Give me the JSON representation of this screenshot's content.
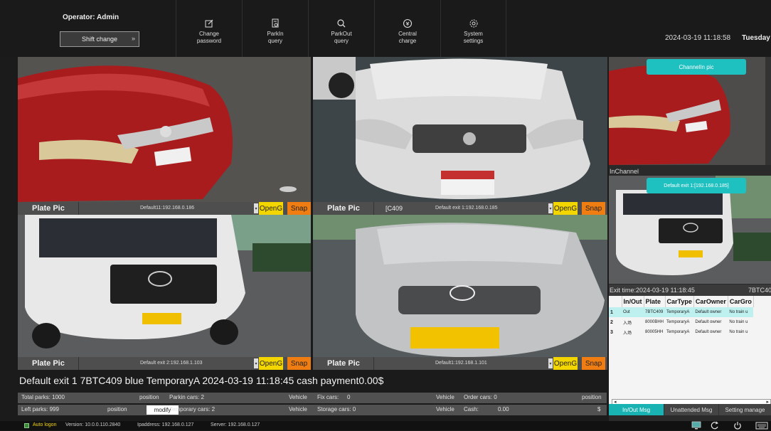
{
  "operator": {
    "label": "Operator:",
    "name": "Admin"
  },
  "shift_change": "Shift change",
  "nav": [
    {
      "label": "Change\npassword",
      "icon": "edit-icon"
    },
    {
      "label": "ParkIn\nquery",
      "icon": "parkin-query-icon"
    },
    {
      "label": "ParkOut\nquery",
      "icon": "search-icon"
    },
    {
      "label": "Central\ncharge",
      "icon": "coin-icon"
    },
    {
      "label": "System\nsettings",
      "icon": "gear-icon"
    }
  ],
  "datetime": "2024-03-19 11:18:58",
  "weekday": "Tuesday",
  "cameras": [
    {
      "plate_label": "Plate Pic",
      "plate_text": "",
      "ip": "Default11:192.168.0.186",
      "open": "OpenG",
      "snap": "Snap"
    },
    {
      "plate_label": "Plate Pic",
      "plate_text": "[C409",
      "ip": "Default exit 1:192.168.0.185",
      "open": "OpenG",
      "snap": "Snap"
    },
    {
      "plate_label": "Plate Pic",
      "plate_text": "",
      "ip": "Default exit 2:192.168.1.103",
      "open": "OpenG",
      "snap": "Snap"
    },
    {
      "plate_label": "Plate Pic",
      "plate_text": "",
      "ip": "Default1:192.168.1.101",
      "open": "OpenG",
      "snap": "Snap"
    }
  ],
  "info_line": "Default exit 1  7BTC409  blue  TemporaryA  2024-03-19 11:18:45  cash payment0.00$",
  "stats": {
    "total_parks": "Total parks: 1000",
    "left_parks": "Left parks: 999",
    "position1": "position",
    "position2": "position",
    "modify": "modify",
    "parkin_cars": "Parkin cars: 2",
    "temporary_cars": "Temporary cars: 2",
    "vehicle1": "Vehicle",
    "vehicle2": "Vehicle",
    "fix_cars": "Fix cars:",
    "fix_cars_val": "0",
    "storage_cars": "Storage cars: 0",
    "vehicle3": "Vehicle",
    "vehicle4": "Vehicle",
    "order_cars": "Order cars: 0",
    "cash": "Cash:",
    "cash_val": "0.00",
    "position3": "position",
    "currency": "$"
  },
  "right": {
    "channel_pic": "ChannelIn pic",
    "inchannel": "InChannel",
    "exit_btn": "Default exit 1:[192.168.0.185]",
    "exit_time": "Exit time:2024-03-19 11:18:45",
    "exit_plate": "7BTC40",
    "columns": [
      "In/Out",
      "Plate",
      "CarType",
      "CarOwner",
      "CarGro"
    ],
    "rows": [
      {
        "idx": "1",
        "inout": "Out",
        "plate": "7BTC409",
        "cartype": "TemporaryA",
        "owner": "Default owner",
        "group": "No train u"
      },
      {
        "idx": "2",
        "inout": "入场",
        "plate": "8000BHH",
        "cartype": "TemporaryA",
        "owner": "Default owner",
        "group": "No train u"
      },
      {
        "idx": "3",
        "inout": "入场",
        "plate": "80005HH",
        "cartype": "TemporaryA",
        "owner": "Default owner",
        "group": "No train u"
      }
    ],
    "tabs": [
      "In/Out Msg",
      "Unattended Msg",
      "Setting manage"
    ]
  },
  "footer": {
    "auto_logon": "Auto logon",
    "version": "Version: 10.0.0.110.2840",
    "ipaddress": "Ipaddress: 192.168.0.127",
    "server": "Server: 192.168.0.127"
  },
  "colors": {
    "accent_cyan": "#1fc0c0",
    "open_yellow": "#f3d600",
    "snap_orange": "#f07d12"
  }
}
